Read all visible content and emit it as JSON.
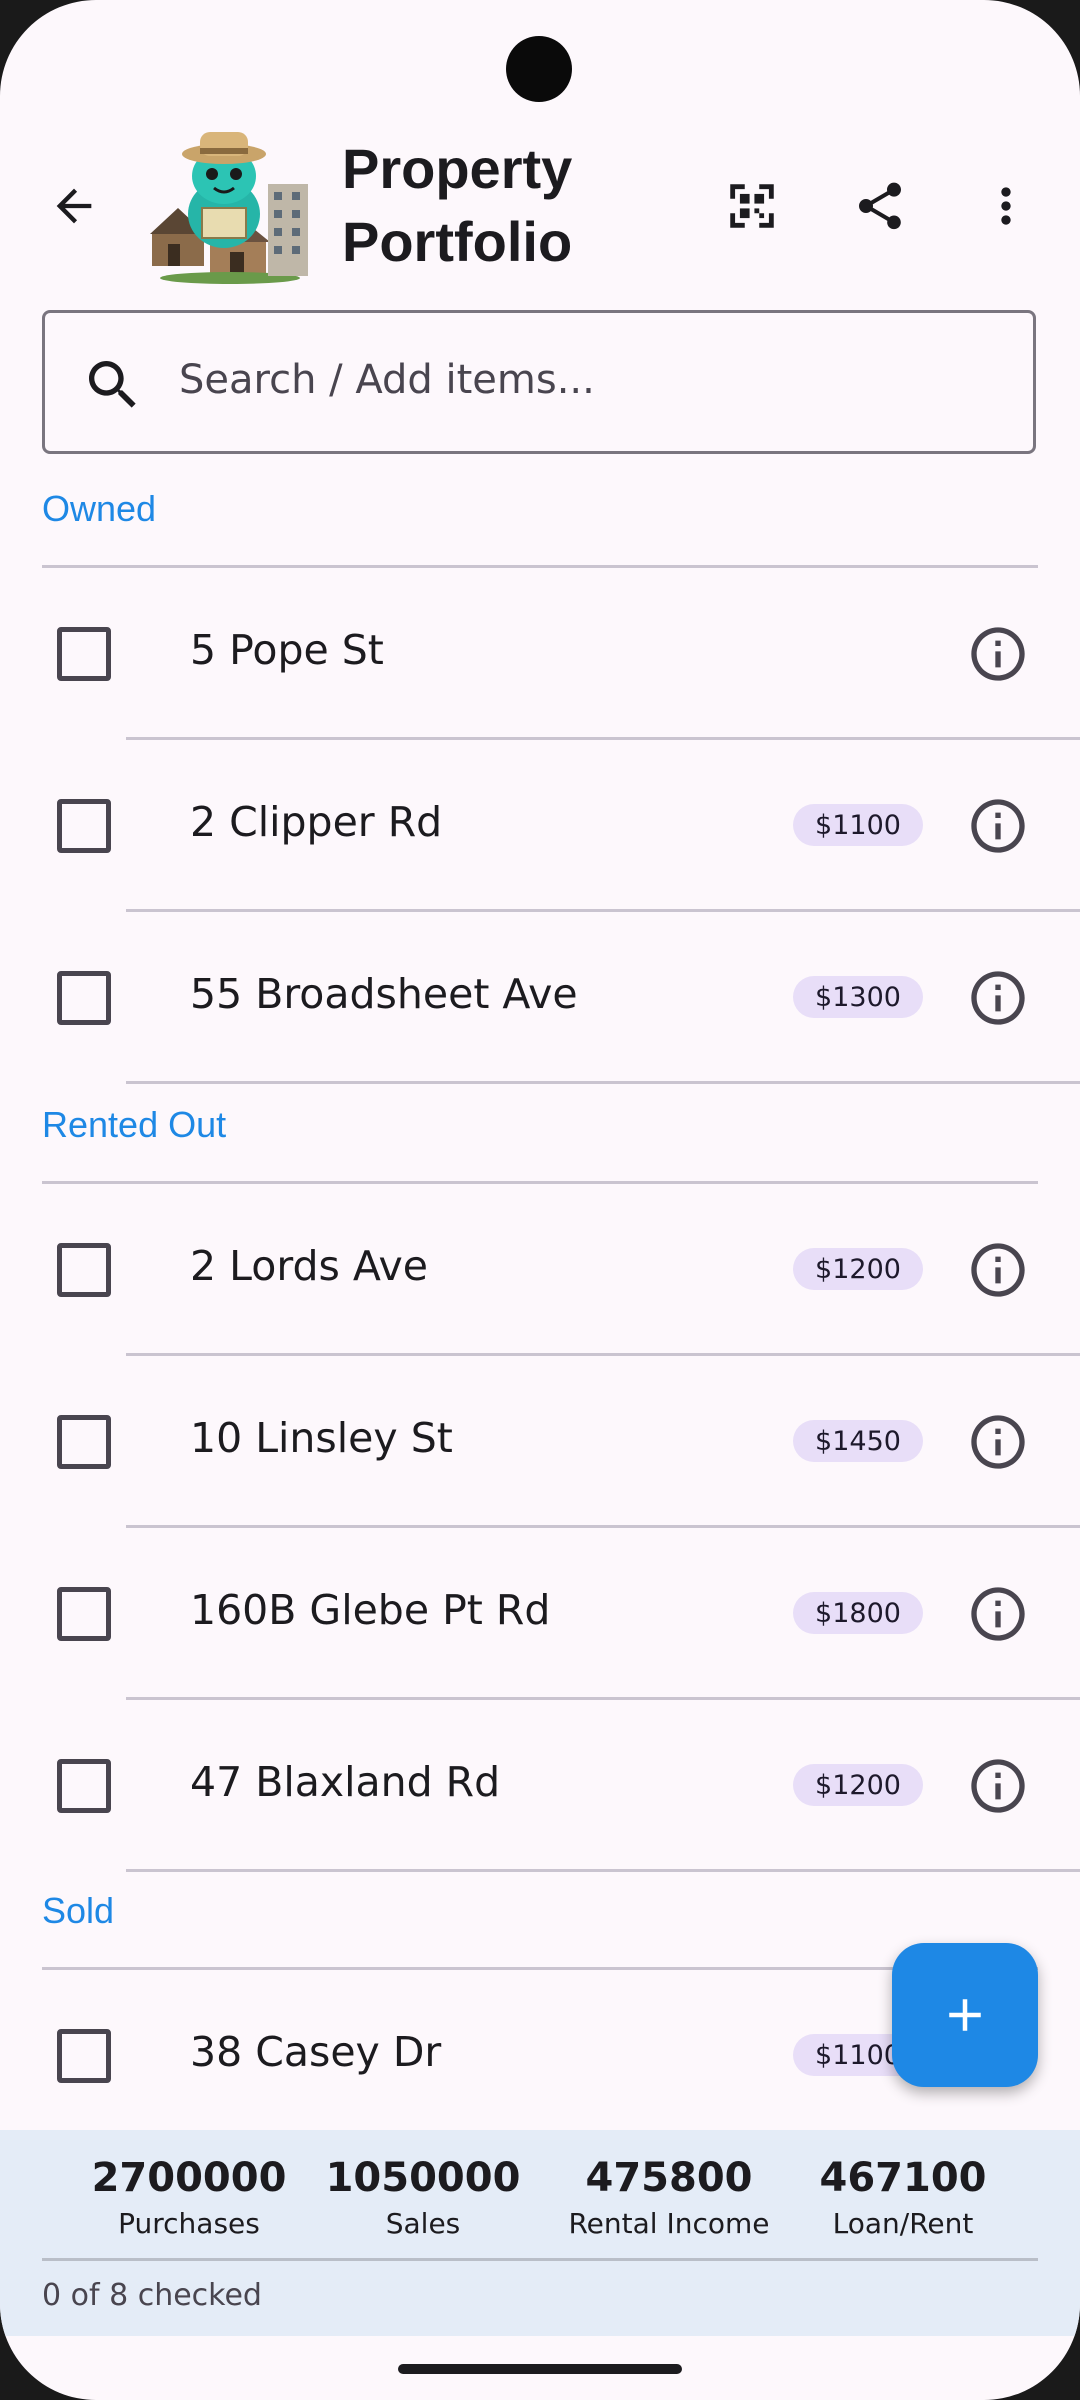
{
  "app": {
    "title": "Property Portfolio"
  },
  "colors": {
    "accent": "#1e88e5",
    "chip_bg": "#e8def8",
    "summary_bg": "#e4ecf7"
  },
  "icons": {
    "back": "arrow-back-icon",
    "qr": "qr-code-icon",
    "share": "share-icon",
    "more": "more-vert-icon",
    "search": "search-icon",
    "info": "info-icon",
    "add": "add-icon"
  },
  "search": {
    "placeholder": "Search / Add items..."
  },
  "sections": [
    {
      "title": "Owned",
      "items": [
        {
          "label": "5 Pope St",
          "price": ""
        },
        {
          "label": "2 Clipper Rd",
          "price": "$1100"
        },
        {
          "label": "55 Broadsheet Ave",
          "price": "$1300"
        }
      ]
    },
    {
      "title": "Rented Out",
      "items": [
        {
          "label": "2 Lords Ave",
          "price": "$1200"
        },
        {
          "label": "10 Linsley St",
          "price": "$1450"
        },
        {
          "label": "160B Glebe Pt Rd",
          "price": "$1800"
        },
        {
          "label": "47 Blaxland Rd",
          "price": "$1200"
        }
      ]
    },
    {
      "title": "Sold",
      "items": [
        {
          "label": "38 Casey Dr",
          "price": "$1100"
        }
      ]
    }
  ],
  "summary": {
    "stats": [
      {
        "value": "2700000",
        "label": "Purchases"
      },
      {
        "value": "1050000",
        "label": "Sales"
      },
      {
        "value": "475800",
        "label": "Rental Income"
      },
      {
        "value": "467100",
        "label": "Loan/Rent"
      }
    ],
    "checked_text": "0 of 8 checked"
  }
}
